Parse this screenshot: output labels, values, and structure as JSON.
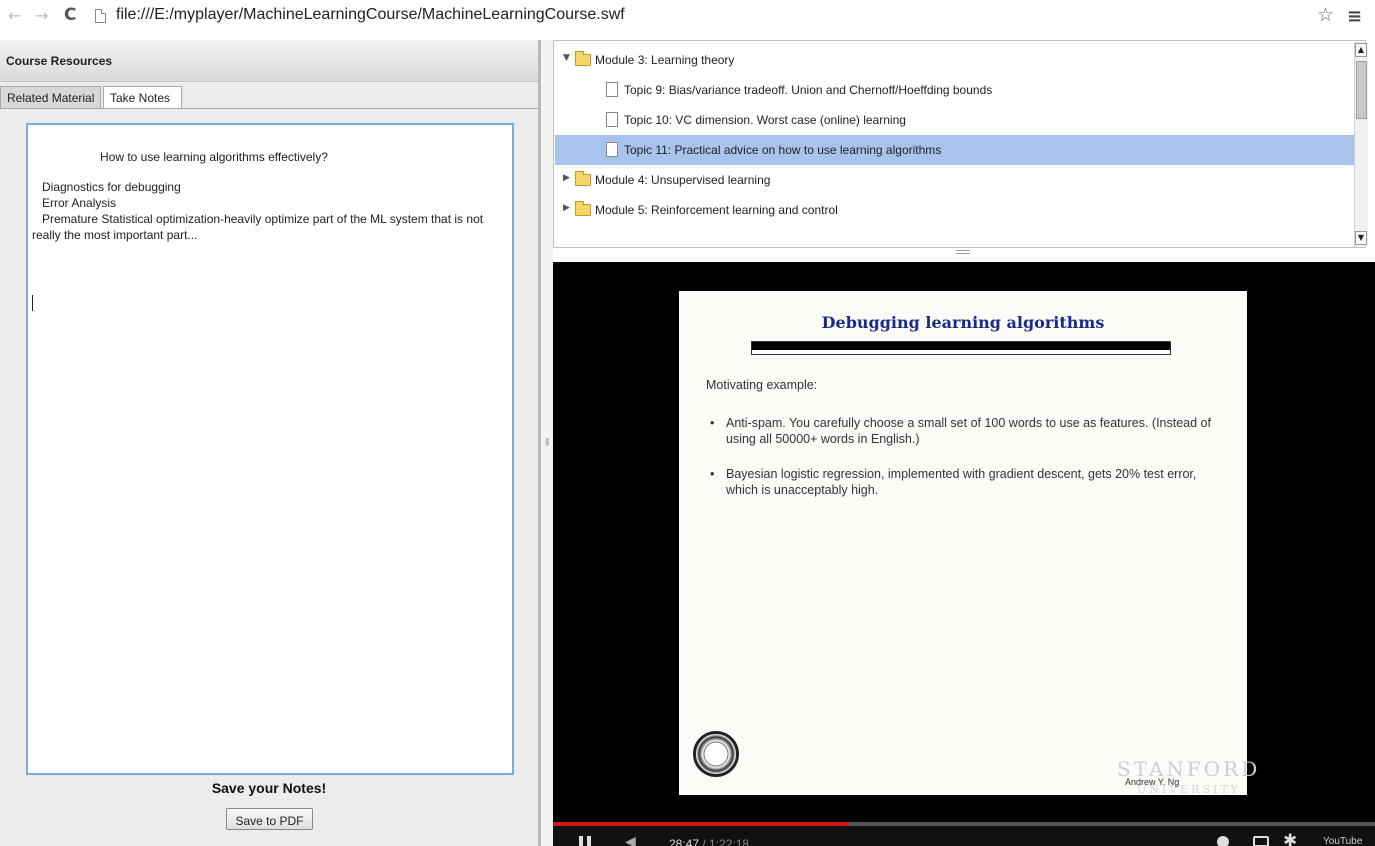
{
  "browser": {
    "back_icon": "←",
    "forward_icon": "→",
    "reload_icon": "C",
    "url": "file:///E:/myplayer/MachineLearningCourse/MachineLearningCourse.swf",
    "star_icon": "☆",
    "menu_icon": "≡"
  },
  "resources": {
    "title": "Course Resources",
    "tabs": [
      {
        "label": "Related Material"
      },
      {
        "label": "Take Notes"
      }
    ],
    "notes": {
      "heading": "How to use learning algorithms effectively?",
      "lines": [
        "   Diagnostics for debugging",
        "   Error Analysis",
        "   Premature Statistical optimization-heavily optimize part of the ML system that is not",
        "really the most important part..."
      ]
    },
    "save_title": "Save your Notes!",
    "save_button": "Save to PDF"
  },
  "tree": {
    "items": [
      {
        "label": "Module 3: Learning theory",
        "type": "module",
        "expanded": true
      },
      {
        "label": "Topic 9: Bias/variance tradeoff. Union and Chernoff/Hoeffding bounds",
        "type": "topic"
      },
      {
        "label": "Topic 10: VC dimension. Worst case (online) learning",
        "type": "topic"
      },
      {
        "label": "Topic 11: Practical advice on how to use learning algorithms",
        "type": "topic",
        "selected": true
      },
      {
        "label": "Module 4: Unsupervised learning",
        "type": "module",
        "expanded": false
      },
      {
        "label": "Module 5: Reinforcement learning and control",
        "type": "module",
        "expanded": false
      }
    ],
    "scroll_up": "▲",
    "scroll_down": "▼"
  },
  "video": {
    "slide": {
      "title": "Debugging learning algorithms",
      "intro": "Motivating example:",
      "bullets": [
        "Anti-spam.  You carefully choose a small set of 100 words to use as features.  (Instead of using all 50000+ words in English.)",
        "Bayesian logistic regression, implemented with gradient descent,  gets 20% test error, which is unacceptably high."
      ],
      "author": "Andrew Y. Ng",
      "wordmark": "STANFORD",
      "wordmark_sub": "UNIVERSITY"
    },
    "progress_fraction": 0.36,
    "current_time": "28:47",
    "duration": " / 1:22:18",
    "volume_icon": "◀",
    "gear_icon": "✱",
    "logo": "YouTube"
  }
}
